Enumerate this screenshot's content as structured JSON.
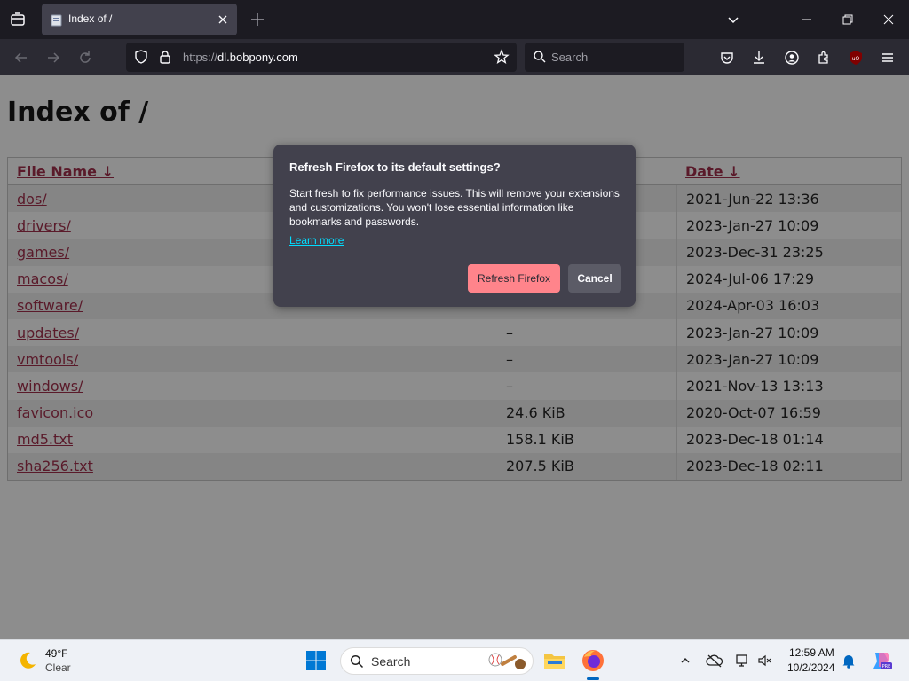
{
  "browser": {
    "tab_title": "Index of /",
    "url_scheme": "https://",
    "url_host": "dl.bobpony.com",
    "search_placeholder": "Search"
  },
  "page": {
    "title": "Index of /",
    "columns": {
      "name": "File Name  ↓",
      "date": "Date  ↓"
    },
    "rows": [
      {
        "name": "dos/",
        "size": "",
        "date": "2021-Jun-22 13:36"
      },
      {
        "name": "drivers/",
        "size": "",
        "date": "2023-Jan-27 10:09"
      },
      {
        "name": "games/",
        "size": "",
        "date": "2023-Dec-31 23:25"
      },
      {
        "name": "macos/",
        "size": "",
        "date": "2024-Jul-06 17:29"
      },
      {
        "name": "software/",
        "size": "–",
        "date": "2024-Apr-03 16:03"
      },
      {
        "name": "updates/",
        "size": "–",
        "date": "2023-Jan-27 10:09"
      },
      {
        "name": "vmtools/",
        "size": "–",
        "date": "2023-Jan-27 10:09"
      },
      {
        "name": "windows/",
        "size": "–",
        "date": "2021-Nov-13 13:13"
      },
      {
        "name": "favicon.ico",
        "size": "24.6 KiB",
        "date": "2020-Oct-07 16:59"
      },
      {
        "name": "md5.txt",
        "size": "158.1 KiB",
        "date": "2023-Dec-18 01:14"
      },
      {
        "name": "sha256.txt",
        "size": "207.5 KiB",
        "date": "2023-Dec-18 02:11"
      }
    ]
  },
  "dialog": {
    "title": "Refresh Firefox to its default settings?",
    "body": "Start fresh to fix performance issues. This will remove your extensions and customizations. You won't lose essential information like bookmarks and passwords.",
    "link": "Learn more",
    "primary_button": "Refresh Firefox",
    "secondary_button": "Cancel"
  },
  "taskbar": {
    "weather_temp": "49°F",
    "weather_condition": "Clear",
    "search_placeholder": "Search",
    "time": "12:59 AM",
    "date": "10/2/2024"
  },
  "colors": {
    "dialog_bg": "#42414d",
    "primary_button": "#ff848b",
    "link_accent": "#00ddff",
    "chrome_bg": "#1c1b22"
  }
}
